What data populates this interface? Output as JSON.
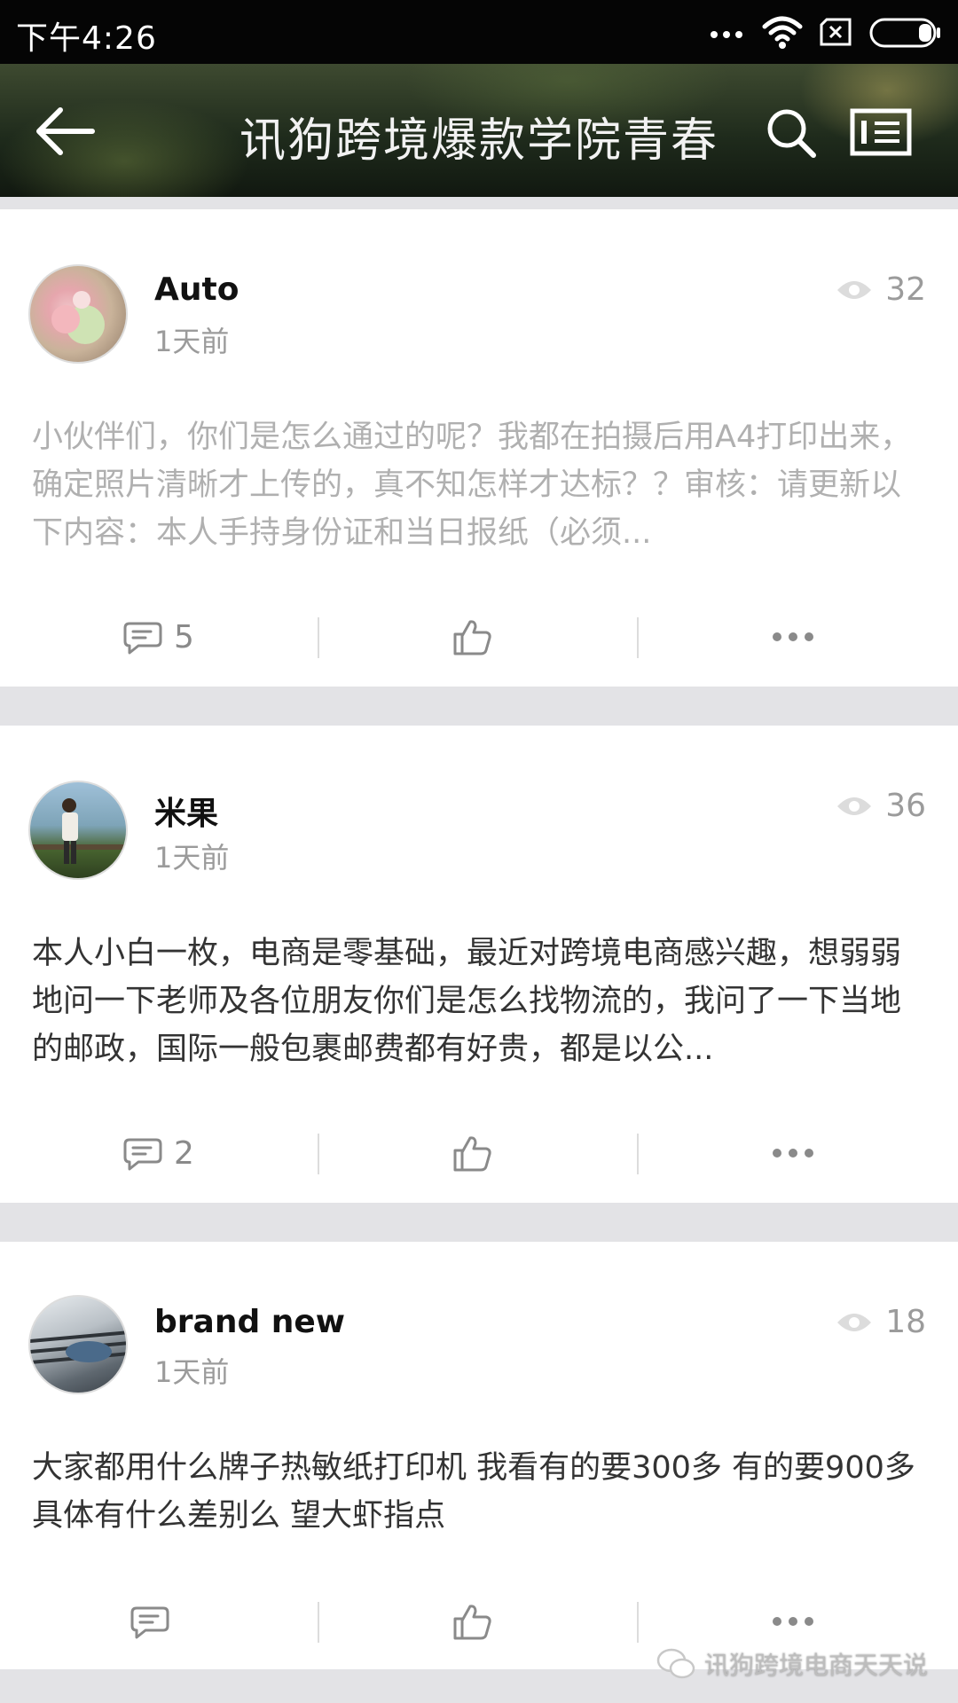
{
  "status_bar": {
    "time": "下午4:26",
    "icons": [
      "more-dots-icon",
      "wifi-icon",
      "sim-x-icon",
      "battery-icon"
    ]
  },
  "app_bar": {
    "title": "讯狗跨境爆款学院青春",
    "icons": [
      "back-arrow-icon",
      "search-icon",
      "group-info-icon"
    ]
  },
  "posts": [
    {
      "author": "Auto",
      "time": "1天前",
      "views": "32",
      "content": "小伙伴们，你们是怎么通过的呢？我都在拍摄后用A4打印出来，确定照片清晰才上传的，真不知怎样才达标？？审核：请更新以下内容：本人手持身份证和当日报纸（必须...",
      "comments": "5",
      "faded": true
    },
    {
      "author": "米果",
      "time": "1天前",
      "views": "36",
      "content": "本人小白一枚，电商是零基础，最近对跨境电商感兴趣，想弱弱地问一下老师及各位朋友你们是怎么找物流的，我问了一下当地的邮政，国际一般包裹邮费都有好贵，都是以公...",
      "comments": "2",
      "faded": false
    },
    {
      "author": "brand new",
      "time": "1天前",
      "views": "18",
      "content": "大家都用什么牌子热敏纸打印机 我看有的要300多 有的要900多 具体有什么差别么 望大虾指点",
      "comments": "",
      "faded": false
    }
  ],
  "watermark": {
    "text": "讯狗跨境电商天天说"
  },
  "colors": {
    "background": "#e3e3e6",
    "card": "#ffffff",
    "muted_text": "#9b9b9b",
    "body_text": "#333333"
  }
}
